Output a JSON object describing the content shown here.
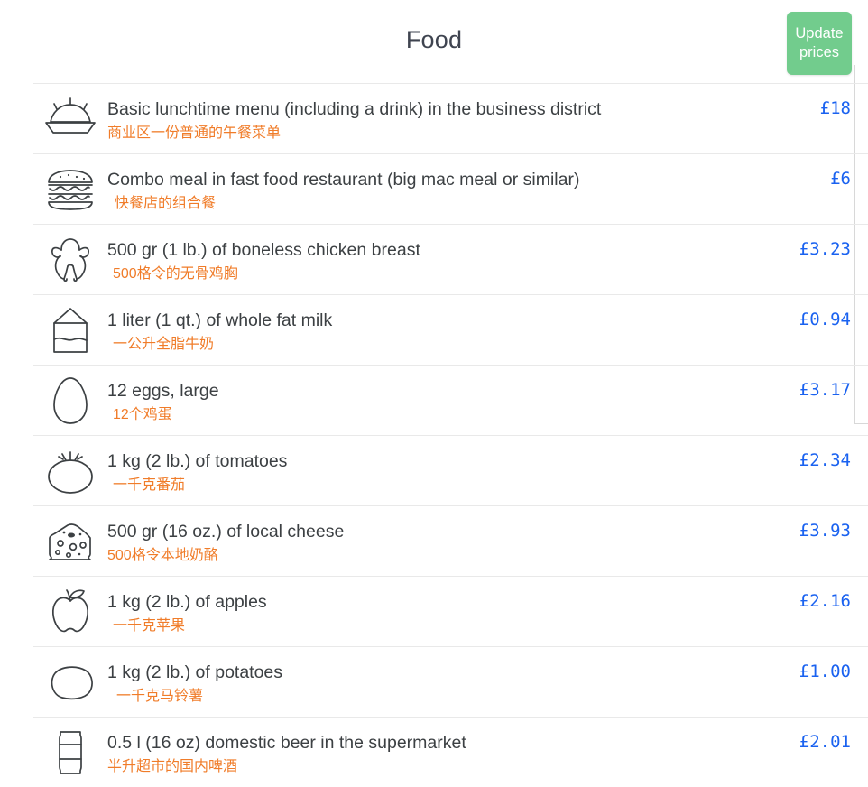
{
  "header": {
    "title": "Food",
    "update_button_label": "Update prices",
    "update_button_line1": "Update",
    "update_button_line2": "prices",
    "accent_green": "#72cc8d"
  },
  "colors": {
    "price_blue": "#1a62f0",
    "translation_orange": "#f07c29",
    "label_grey": "#3c4043",
    "divider": "#e9e9e9"
  },
  "rows": [
    {
      "icon": "covered-dish-icon",
      "label_en": "Basic lunchtime menu (including a drink) in the business district",
      "label_zh": "商业区一份普通的午餐菜单",
      "price": "£18",
      "indent": 0
    },
    {
      "icon": "burger-icon",
      "label_en": "Combo meal in fast food restaurant (big mac meal or similar)",
      "label_zh": "快餐店的组合餐",
      "price": "£6",
      "indent": 2
    },
    {
      "icon": "chicken-icon",
      "label_en": "500 gr (1 lb.) of boneless chicken breast",
      "label_zh": "500格令的无骨鸡胸",
      "price": "£3.23",
      "indent": 1
    },
    {
      "icon": "milk-carton-icon",
      "label_en": "1 liter (1 qt.) of whole fat milk",
      "label_zh": "一公升全脂牛奶",
      "price": "£0.94",
      "indent": 1
    },
    {
      "icon": "egg-icon",
      "label_en": "12 eggs, large",
      "label_zh": "12个鸡蛋",
      "price": "£3.17",
      "indent": 1
    },
    {
      "icon": "tomato-icon",
      "label_en": "1 kg (2 lb.) of tomatoes",
      "label_zh": "一千克番茄",
      "price": "£2.34",
      "indent": 1
    },
    {
      "icon": "cheese-icon",
      "label_en": "500 gr (16 oz.) of local cheese",
      "label_zh": "500格令本地奶酪",
      "price": "£3.93",
      "indent": 0
    },
    {
      "icon": "apple-icon",
      "label_en": "1 kg (2 lb.) of apples",
      "label_zh": "一千克苹果",
      "price": "£2.16",
      "indent": 1
    },
    {
      "icon": "potato-icon",
      "label_en": "1 kg (2 lb.) of potatoes",
      "label_zh": "一千克马铃薯",
      "price": "£1.00",
      "indent": 3
    },
    {
      "icon": "beer-can-icon",
      "label_en": "0.5 l (16 oz) domestic beer in the supermarket",
      "label_zh": "半升超市的国内啤酒",
      "price": "£2.01",
      "indent": 0
    }
  ]
}
